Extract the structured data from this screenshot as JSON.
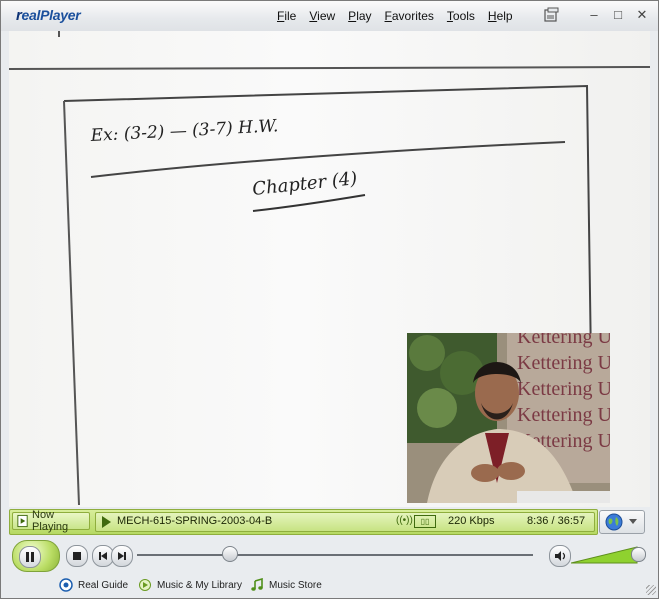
{
  "app": {
    "logo_text": "realPlayer",
    "logo_r": "r",
    "logo_rest": "ealPlayer"
  },
  "menu": [
    "File",
    "View",
    "Play",
    "Favorites",
    "Tools",
    "Help"
  ],
  "window_controls": {
    "minimize": "–",
    "maximize": "□",
    "close": "✕"
  },
  "now_playing": {
    "tab_label": "Now Playing",
    "clip_title": "MECH-615-SPRING-2003-04-B",
    "signal_icon": "((•))",
    "bitrate": "220 Kbps",
    "timecode": "8:36 / 36:57",
    "progress_fraction": 0.233
  },
  "volume_fraction": 0.95,
  "bottom_links": [
    {
      "label": "Real Guide",
      "icon": "real-guide-icon"
    },
    {
      "label": "Music & My Library",
      "icon": "music-library-icon"
    },
    {
      "label": "Music Store",
      "icon": "music-note-icon"
    }
  ],
  "video": {
    "board_text_1": "Ex: (3-2) — (3-7) H.W.",
    "board_text_2": "Chapter (4)",
    "pip_banner": [
      "Kettering U",
      "Kettering U",
      "Kettering U",
      "Kettering U",
      "Kettering U"
    ]
  },
  "colors": {
    "accent_green": "#b6d963",
    "logo_blue": "#1a4f9c"
  }
}
